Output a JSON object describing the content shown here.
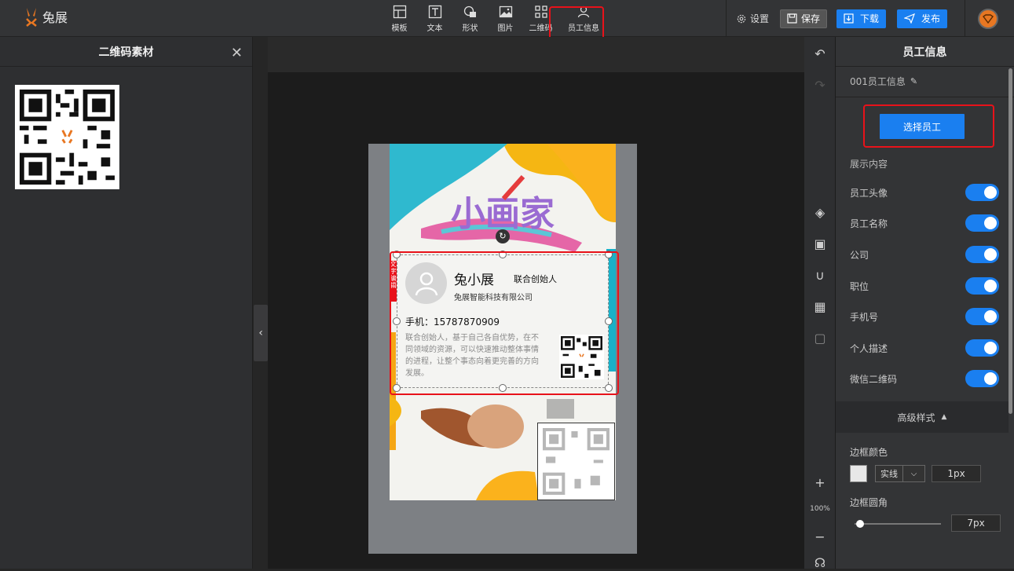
{
  "app": {
    "logo_text": "兔展"
  },
  "toolbar": {
    "tools": [
      {
        "label": "模板",
        "icon": "template-icon"
      },
      {
        "label": "文本",
        "icon": "text-icon"
      },
      {
        "label": "形状",
        "icon": "shape-icon"
      },
      {
        "label": "图片",
        "icon": "image-icon"
      },
      {
        "label": "二维码",
        "icon": "qrcode-icon"
      },
      {
        "label": "员工信息",
        "icon": "employee-icon"
      }
    ],
    "settings_label": "设置",
    "save_label": "保存",
    "download_label": "下载",
    "publish_label": "发布"
  },
  "left_panel": {
    "title": "二维码素材"
  },
  "canvas": {
    "poster_title": "小画家",
    "employee": {
      "name": "兔小展",
      "position": "联合创始人",
      "company": "兔展智能科技有限公司",
      "phone": "手机：15787870909",
      "description": "联合创始人，基于自己各自优势，在不同领域的资源，可以快速推动整体事情的进程，让整个事态向着更完善的方向发展。",
      "side_tag": "文字编辑"
    }
  },
  "side_toolbar": {
    "zoom": "100%"
  },
  "right_panel": {
    "title": "员工信息",
    "name": "001员工信息",
    "select_button": "选择员工",
    "section_label": "展示内容",
    "toggles": [
      {
        "label": "员工头像",
        "on": true
      },
      {
        "label": "员工名称",
        "on": true
      },
      {
        "label": "公司",
        "on": true
      },
      {
        "label": "职位",
        "on": true
      },
      {
        "label": "手机号",
        "on": true
      },
      {
        "label": "个人描述",
        "on": true
      },
      {
        "label": "微信二维码",
        "on": true
      }
    ],
    "advanced_label": "高级样式",
    "border_color_label": "边框颜色",
    "border_style": "实线",
    "border_width": "1px",
    "border_radius_label": "边框圆角",
    "border_radius": "7px"
  },
  "colors": {
    "accent": "#1a7ff0",
    "highlight": "#e8121a",
    "logo": "#e87722"
  }
}
